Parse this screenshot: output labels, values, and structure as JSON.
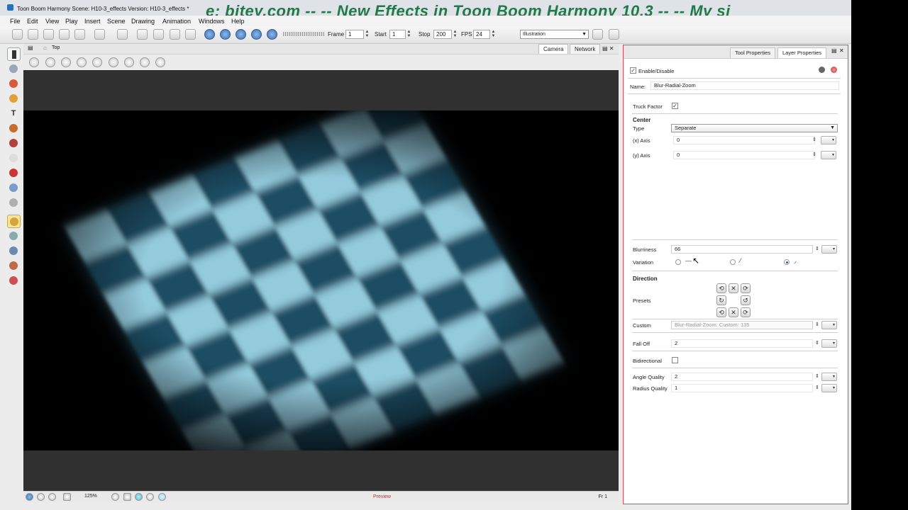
{
  "window": {
    "title": "Toon Boom Harmony Scene: H10-3_effects Version: H10-3_effects *",
    "banner": "e: bitey.com -- --   New Effects in Toon Boom Harmony 10.3 -- -- My si"
  },
  "menu": [
    "File",
    "Edit",
    "View",
    "Play",
    "Insert",
    "Scene",
    "Drawing",
    "Animation",
    "Windows",
    "Help"
  ],
  "toolbar": {
    "frame_label": "Frame",
    "frame_value": "1",
    "start_label": "Start",
    "start_value": "1",
    "stop_label": "Stop",
    "stop_value": "200",
    "fps_label": "FPS",
    "fps_value": "24",
    "workspace": "Illustration"
  },
  "view": {
    "breadcrumb": "Top",
    "tabs": [
      "Camera",
      "Network"
    ],
    "zoom": "125%",
    "preview_label": "Preview",
    "frame_indicator": "Fr 1"
  },
  "panel": {
    "tabs": [
      "Tool Properties",
      "Layer Properties"
    ],
    "enable_label": "Enable/Disable",
    "name_label": "Name:",
    "name_value": "Blur-Radial-Zoom",
    "truck_factor_label": "Truck Factor",
    "center_heading": "Center",
    "type_label": "Type",
    "type_value": "Separate",
    "x_axis_label": "(x) Axis",
    "x_axis_value": "0",
    "y_axis_label": "(y) Axis",
    "y_axis_value": "0",
    "blurriness_label": "Blurriness",
    "blurriness_value": "66",
    "variation_label": "Variation",
    "direction_heading": "Direction",
    "presets_label": "Presets",
    "custom_label": "Custom",
    "custom_value": "Blur-Radial-Zoom: Custom: 135",
    "falloff_label": "Fall Off",
    "falloff_value": "2",
    "bidirectional_label": "Bidirectional",
    "angle_quality_label": "Angle Quality",
    "angle_quality_value": "2",
    "radius_quality_label": "Radius Quality",
    "radius_quality_value": "1"
  }
}
